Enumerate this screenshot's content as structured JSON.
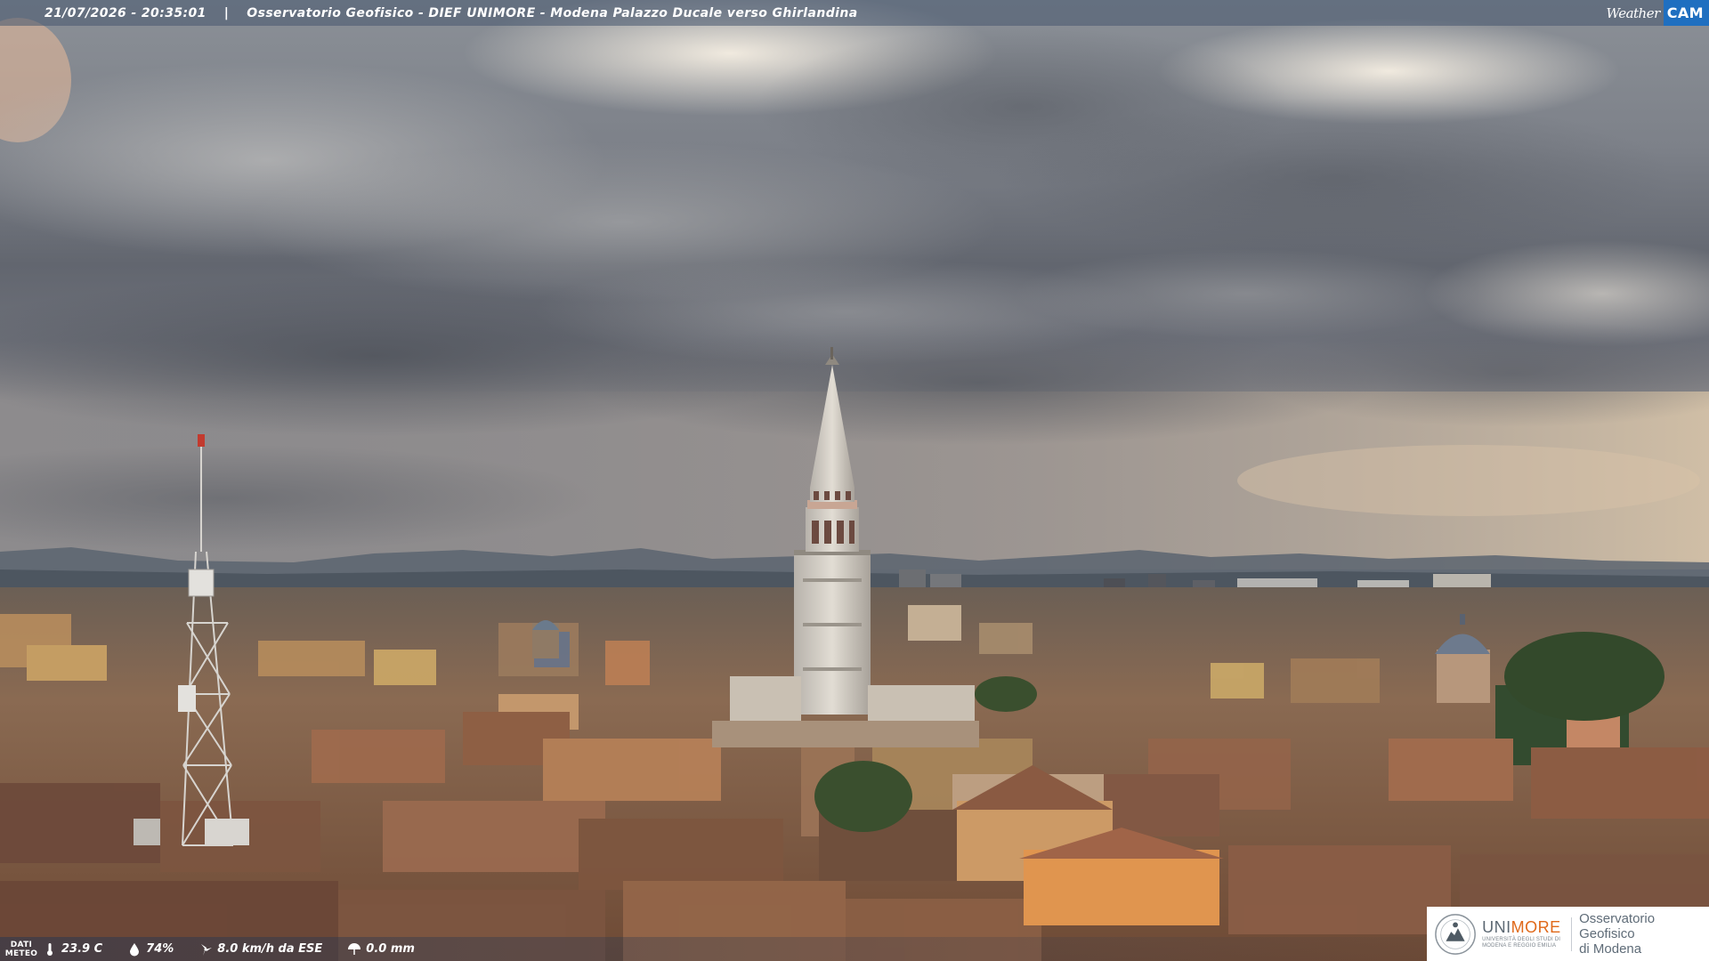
{
  "overlay": {
    "timestamp": "21/07/2026 - 20:35:01",
    "separator": "|",
    "station": "Osservatorio Geofisico - DIEF UNIMORE - Modena Palazzo Ducale verso Ghirlandina",
    "brand_weather": "Weather",
    "brand_cam": "CAM"
  },
  "weather_data": {
    "label_line1": "DATI",
    "label_line2": "METEO",
    "temperature": "23.9 C",
    "humidity": "74%",
    "wind": "8.0 km/h da ESE",
    "rain": "0.0 mm",
    "icons": [
      "thermometer-icon",
      "humidity-drop-icon",
      "wind-icon",
      "rain-icon"
    ]
  },
  "logo": {
    "uni_prefix": "UNI",
    "uni_suffix": "MORE",
    "uni_subtitle": "UNIVERSITÀ DEGLI STUDI DI MODENA E REGGIO EMILIA",
    "observatory_line1": "Osservatorio Geofisico",
    "observatory_line2": "di Modena"
  },
  "colors": {
    "brand_cam_bg": "#1f6fc0",
    "unimore_orange": "#e0691a",
    "unimore_gray": "#5c6873"
  }
}
